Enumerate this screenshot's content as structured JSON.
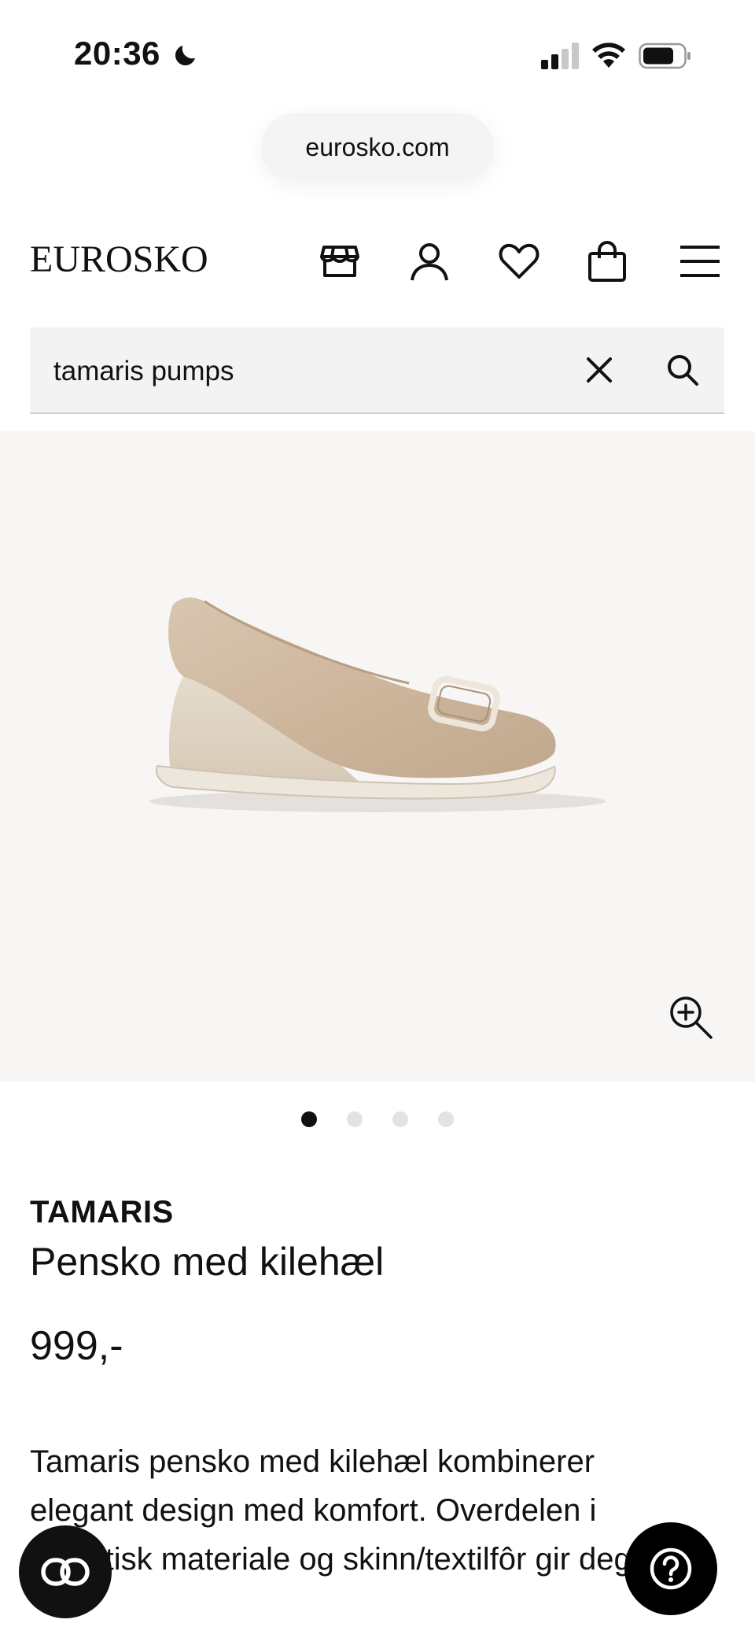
{
  "status_bar": {
    "time": "20:36"
  },
  "browser": {
    "url": "eurosko.com"
  },
  "header": {
    "logo": "EUROSKO"
  },
  "search": {
    "value": "tamaris pumps"
  },
  "gallery": {
    "active_index": 0,
    "count": 4
  },
  "product": {
    "brand": "TAMARIS",
    "name": "Pensko med kilehæl",
    "price": "999,-",
    "description": "Tamaris pensko med kilehæl kombinerer elegant design med komfort. Overdelen i syntetisk materiale og skinn/textilfôr gir deg mer"
  },
  "icons": {
    "header": [
      "store-icon",
      "account-icon",
      "wishlist-heart-icon",
      "shopping-bag-icon",
      "menu-icon"
    ],
    "floating": [
      "chat-link-icon",
      "help-question-icon"
    ]
  }
}
